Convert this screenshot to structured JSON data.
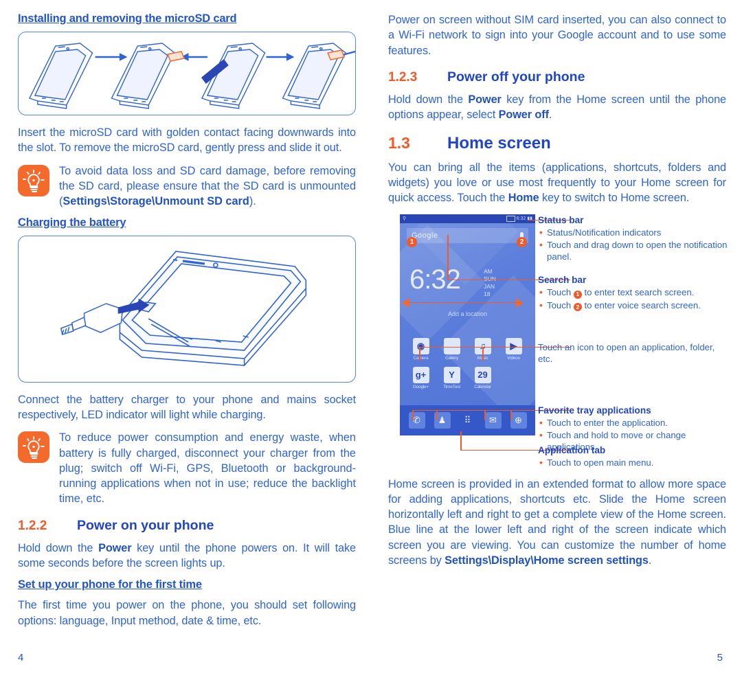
{
  "colors": {
    "heading_blue": "#2145c8",
    "body_blue": "#2f63d8",
    "accent_orange": "#f05a28",
    "tip_orange": "#f4692c"
  },
  "left": {
    "sub_heading_1": "Installing and removing the microSD card",
    "para_1": "Insert the microSD card with golden contact facing downwards into the slot. To remove the microSD card, gently press and slide it out.",
    "tip_1": {
      "icon": "lightbulb-icon",
      "text_before": "To avoid data loss and SD card damage, before removing the SD card, please ensure that the SD card is unmounted (",
      "bold": "Settings\\Storage\\Unmount SD card",
      "text_after": ")."
    },
    "sub_heading_2": "Charging the battery",
    "para_2": "Connect the battery charger to your phone and mains socket respectively, LED indicator will light while charging.",
    "tip_2": {
      "icon": "lightbulb-icon",
      "text": "To reduce power consumption and energy waste, when battery is fully charged, disconnect your charger from the plug; switch off Wi-Fi, GPS, Bluetooth or background-running applications when not in use; reduce the backlight time, etc."
    },
    "section_122": {
      "number": "1.2.2",
      "title": "Power on your phone"
    },
    "para_3_before": "Hold down the ",
    "para_3_bold": "Power",
    "para_3_after": " key until the phone powers on. It will take some seconds before the screen lights up.",
    "sub_heading_3": "Set up your phone for the first time",
    "para_4": "The first time you power on the phone, you should set following options: language, Input method, date & time, etc.",
    "page_number": "4"
  },
  "right": {
    "para_1": "Power on screen without SIM card inserted, you can also connect to a Wi-Fi network to sign into your Google account and to use some features.",
    "section_123": {
      "number": "1.2.3",
      "title": "Power off your phone"
    },
    "para_2_before": "Hold down the ",
    "para_2_bold_1": "Power",
    "para_2_mid": " key from the Home screen until the phone options appear, select ",
    "para_2_bold_2": "Power off",
    "para_2_after": ".",
    "section_13": {
      "number": "1.3",
      "title": "Home screen"
    },
    "para_3_before": "You can bring all the items (applications, shortcuts, folders and widgets) you love or use most frequently to your Home screen for quick access. Touch the ",
    "para_3_bold": "Home",
    "para_3_after": " key to switch to Home screen.",
    "para_4_before": "Home screen is provided in an extended format to allow more space for adding applications, shortcuts etc. Slide the Home screen horizontally left and right to get a complete view of the Home screen. Blue line at the lower left and right of the screen indicate which screen you are viewing. You can customize the number of home screens by ",
    "para_4_bold": "Settings\\Display\\Home screen settings",
    "para_4_after": ".",
    "page_number": "5"
  },
  "phone_mockup": {
    "status_bar": {
      "usb_icon": "usb-icon",
      "battery_icon": "battery-icon",
      "time": "6:32",
      "signal_icon": "signal-icon"
    },
    "search_bar": {
      "logo_text": "Google",
      "mic_icon": "microphone-icon",
      "badge_1": "1",
      "badge_2": "2"
    },
    "clock_widget": {
      "time": "6:32",
      "ampm": "AM",
      "day": "SUN",
      "date": "JAN 18",
      "location_hint": "Add a location"
    },
    "app_row_1": [
      {
        "label": "Camera",
        "icon": "camera-icon",
        "glyph": "◉"
      },
      {
        "label": "Gallery",
        "icon": "gallery-icon",
        "glyph": ""
      },
      {
        "label": "Music",
        "icon": "music-icon",
        "glyph": "♫"
      },
      {
        "label": "Videos",
        "icon": "videos-icon",
        "glyph": "▶"
      }
    ],
    "app_row_2": [
      {
        "label": "Google+",
        "icon": "google-plus-icon",
        "glyph": "g+"
      },
      {
        "label": "TimeTool",
        "icon": "timetool-icon",
        "glyph": "Y"
      },
      {
        "label": "Calendar",
        "icon": "calendar-icon",
        "glyph": "29"
      }
    ],
    "dock": [
      {
        "label": "Phone",
        "icon": "phone-icon",
        "glyph": "✆"
      },
      {
        "label": "Contacts",
        "icon": "contacts-icon",
        "glyph": "♟"
      },
      {
        "label": "Application tab",
        "icon": "app-drawer-icon",
        "glyph": "⠿"
      },
      {
        "label": "Messaging",
        "icon": "messaging-icon",
        "glyph": "✉"
      },
      {
        "label": "Browser",
        "icon": "browser-icon",
        "glyph": "⊕"
      }
    ]
  },
  "annotations": {
    "status_bar": {
      "title": "Status bar",
      "items": [
        "Status/Notification indicators",
        "Touch and drag down to open the notification panel."
      ]
    },
    "search_bar": {
      "title": "Search bar",
      "item_1_before": "Touch ",
      "item_1_badge": "1",
      "item_1_after": " to enter text search screen.",
      "item_2_before": "Touch ",
      "item_2_badge": "2",
      "item_2_after": " to enter voice search screen."
    },
    "app_icon": {
      "text": "Touch an icon to open an application, folder, etc."
    },
    "favorite_tray": {
      "title": "Favorite tray applications",
      "items": [
        "Touch to enter the application.",
        "Touch and hold to move or change applications."
      ]
    },
    "application_tab": {
      "title": "Application tab",
      "items": [
        "Touch to open main menu."
      ]
    }
  }
}
